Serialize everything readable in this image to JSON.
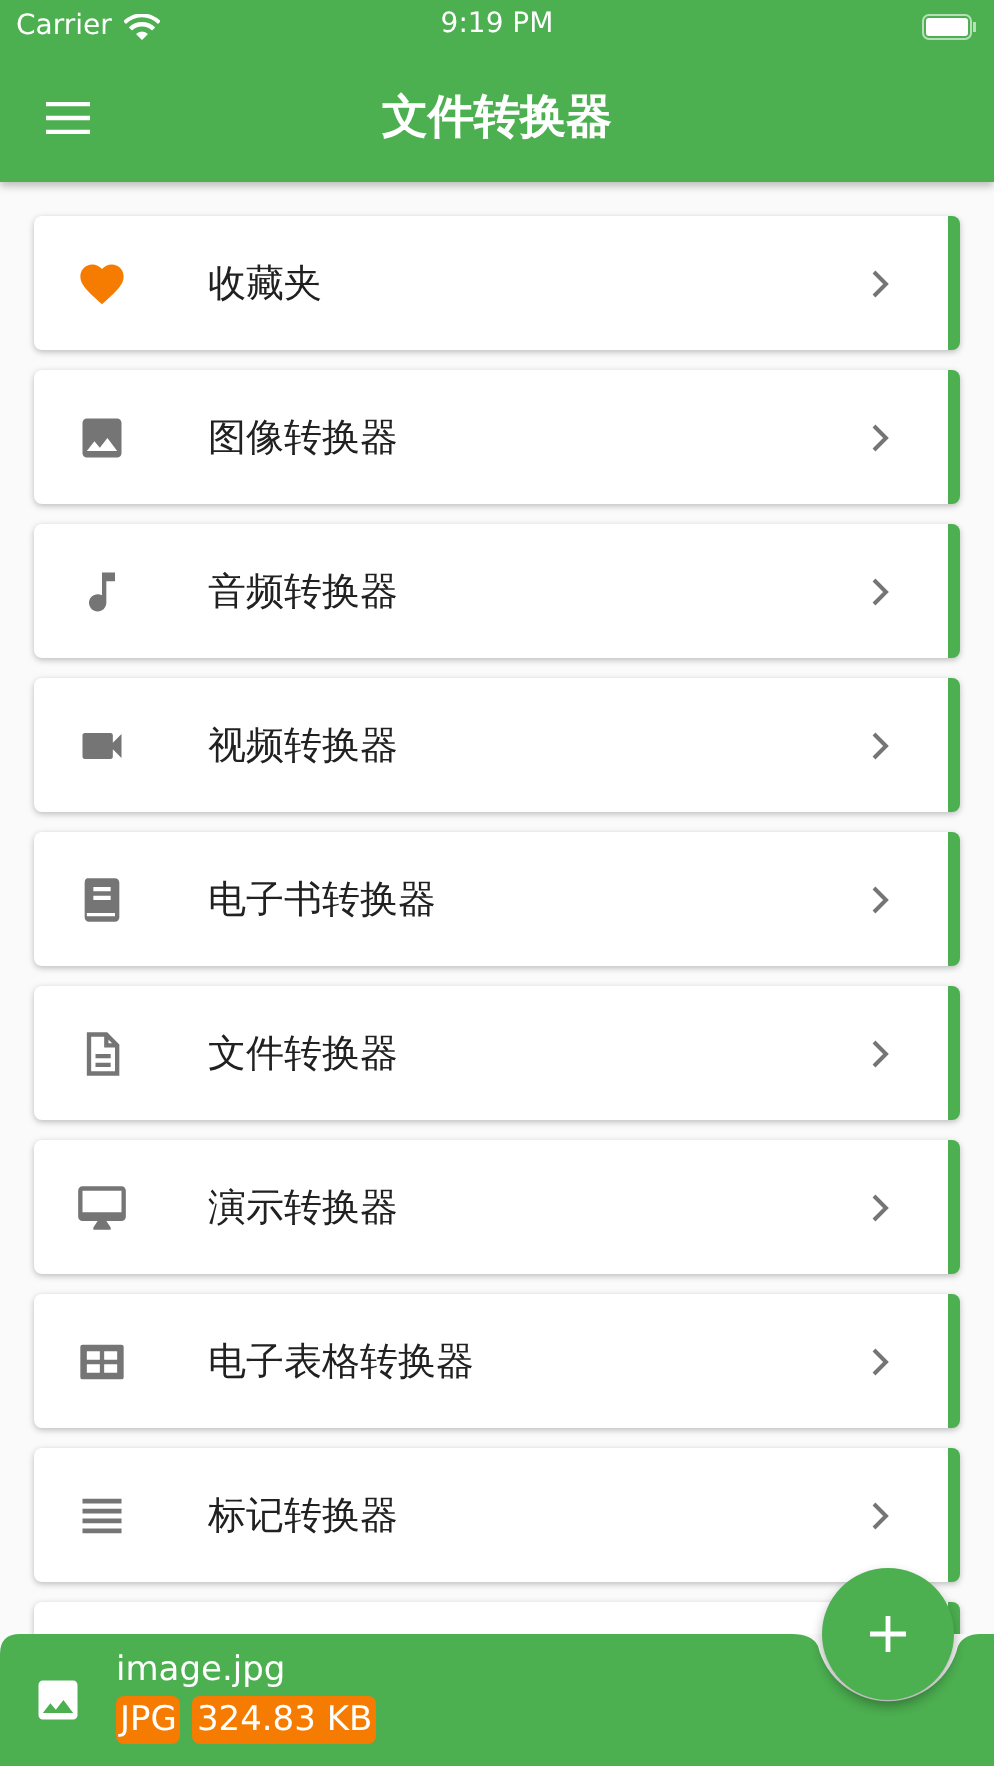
{
  "status_bar": {
    "carrier": "Carrier",
    "time": "9:19 PM"
  },
  "app_bar": {
    "title": "文件转换器"
  },
  "items": [
    {
      "kind": "heart",
      "label": "收藏夹"
    },
    {
      "kind": "image",
      "label": "图像转换器"
    },
    {
      "kind": "music",
      "label": "音频转换器"
    },
    {
      "kind": "video",
      "label": "视频转换器"
    },
    {
      "kind": "book",
      "label": "电子书转换器"
    },
    {
      "kind": "file",
      "label": "文件转换器"
    },
    {
      "kind": "monitor",
      "label": "演示转换器"
    },
    {
      "kind": "table",
      "label": "电子表格转换器"
    },
    {
      "kind": "lines",
      "label": "标记转换器"
    }
  ],
  "current_file": {
    "name": "image.jpg",
    "format": "JPG",
    "size": "324.83 KB"
  }
}
